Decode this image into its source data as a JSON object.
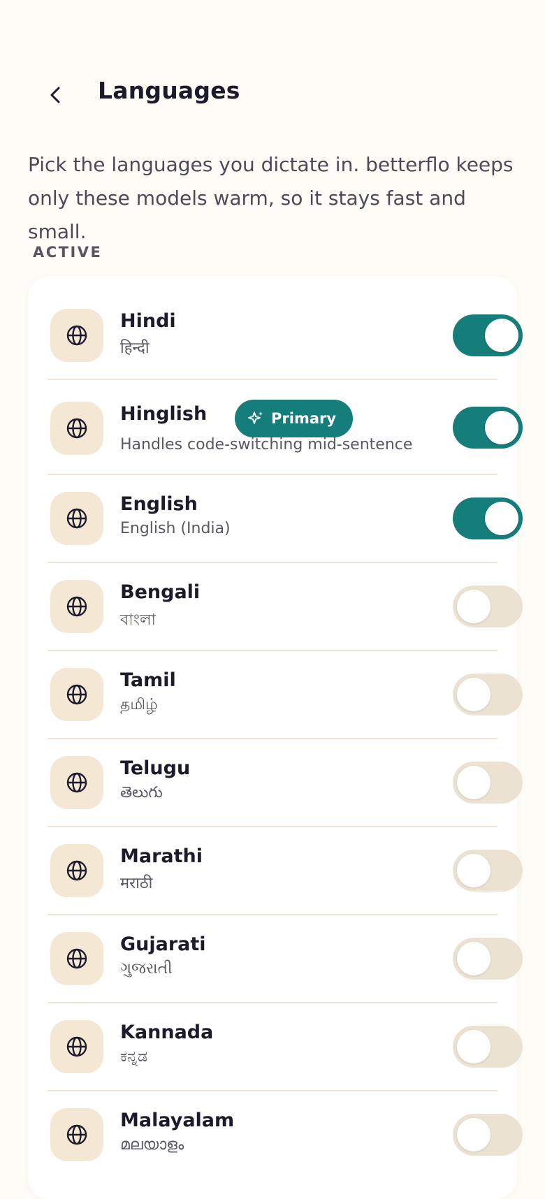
{
  "header": {
    "title": "Languages",
    "back_icon": "chevron-left-icon"
  },
  "description": "Pick the languages you dictate in. betterflo keeps only these models warm, so it stays fast and small.",
  "section_label": "ACTIVE",
  "colors": {
    "accent": "#157d7a",
    "background": "#fdfcf6",
    "icon_tile": "#f4e8d5",
    "toggle_off": "#ece2d1"
  },
  "languages": [
    {
      "name": "Hindi",
      "subtitle": "हिन्दी",
      "enabled": true,
      "icon": "globe-icon"
    },
    {
      "name": "Hinglish",
      "subtitle": "Handles code-switching mid-sentence",
      "enabled": true,
      "badge": "Primary",
      "badge_icon": "sparkle-icon",
      "icon": "globe-icon"
    },
    {
      "name": "English",
      "subtitle": "English (India)",
      "enabled": true,
      "icon": "globe-icon"
    },
    {
      "name": "Bengali",
      "subtitle": "বাংলা",
      "enabled": false,
      "icon": "globe-icon"
    },
    {
      "name": "Tamil",
      "subtitle": "தமிழ்",
      "enabled": false,
      "icon": "globe-icon"
    },
    {
      "name": "Telugu",
      "subtitle": "తెలుగు",
      "enabled": false,
      "icon": "globe-icon"
    },
    {
      "name": "Marathi",
      "subtitle": "मराठी",
      "enabled": false,
      "icon": "globe-icon"
    },
    {
      "name": "Gujarati",
      "subtitle": "ગુજરાતી",
      "enabled": false,
      "icon": "globe-icon"
    },
    {
      "name": "Kannada",
      "subtitle": "ಕನ್ನಡ",
      "enabled": false,
      "icon": "globe-icon"
    },
    {
      "name": "Malayalam",
      "subtitle": "മലയാളം",
      "enabled": false,
      "icon": "globe-icon"
    }
  ]
}
